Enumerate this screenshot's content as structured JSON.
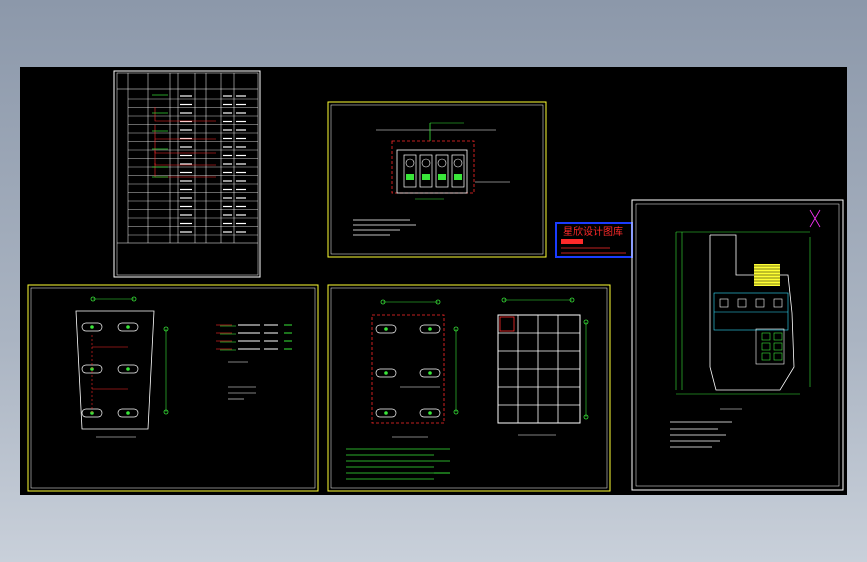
{
  "viewer": {
    "background_color": "#000000",
    "frame_color": "#ffff00",
    "sheet_border_color": "#ffffff"
  },
  "stamp": {
    "title": "星欣设计图库",
    "border_color": "#1a3cff",
    "text_color": "#ff2a2a"
  },
  "sheets": [
    {
      "id": "material-table",
      "kind": "table"
    },
    {
      "id": "box-detail",
      "kind": "detail"
    },
    {
      "id": "cell-layout-left",
      "kind": "plan"
    },
    {
      "id": "cell-layout-right",
      "kind": "plan"
    },
    {
      "id": "grid-plan",
      "kind": "plan"
    },
    {
      "id": "site-plan",
      "kind": "plan"
    }
  ],
  "colors": {
    "green": "#39e639",
    "red": "#ff2a2a",
    "cyan": "#33e0ff",
    "yellow": "#ffff33",
    "magenta": "#ff33ff",
    "white": "#ffffff"
  }
}
